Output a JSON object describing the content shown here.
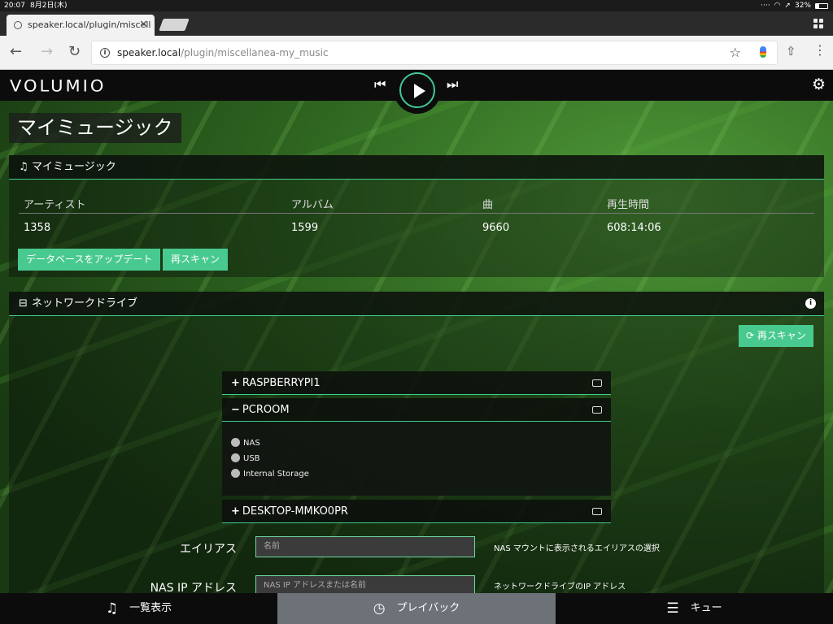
{
  "status_bar": {
    "time": "20:07",
    "date": "8月2日(木)",
    "battery": "32%"
  },
  "browser": {
    "tab_title": "speaker.local/plugin/miscell",
    "url_host": "speaker.local",
    "url_path": "/plugin/miscellanea-my_music"
  },
  "app": {
    "logo": "VOLUMIO"
  },
  "page": {
    "title": "マイミュージック"
  },
  "my_music": {
    "heading": "マイミュージック",
    "columns": [
      "アーティスト",
      "アルバム",
      "曲",
      "再生時間"
    ],
    "values": [
      "1358",
      "1599",
      "9660",
      "608:14:06"
    ],
    "update_db_label": "データベースをアップデート",
    "rescan_label": "再スキャン"
  },
  "network_drives": {
    "heading": "ネットワークドライブ",
    "rescan_label": "再スキャン",
    "drives": [
      {
        "sign": "+",
        "name": "RASPBERRYPI1"
      },
      {
        "sign": "−",
        "name": "PCROOM",
        "options": [
          "NAS",
          "USB",
          "Internal Storage"
        ]
      },
      {
        "sign": "+",
        "name": "DESKTOP-MMKO0PR"
      }
    ]
  },
  "form": {
    "alias_label": "エイリアス",
    "alias_placeholder": "名前",
    "alias_help": "NAS マウントに表示されるエイリアスの選択",
    "ip_label": "NAS IP アドレス",
    "ip_placeholder": "NAS IP アドレスまたは名前",
    "ip_help": "ネットワークドライブのIP アドレス"
  },
  "bottom_nav": [
    {
      "label": "一覧表示",
      "icon": "music-note-icon"
    },
    {
      "label": "プレイバック",
      "icon": "clock-icon"
    },
    {
      "label": "キュー",
      "icon": "list-icon"
    }
  ]
}
